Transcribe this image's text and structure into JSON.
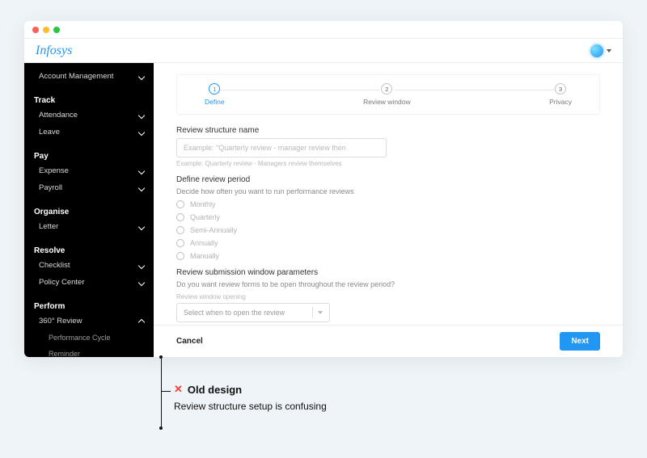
{
  "brand": "Infosys",
  "sidebar": {
    "groups": [
      {
        "title": null,
        "items": [
          {
            "label": "Account Management",
            "expandable": true
          }
        ]
      },
      {
        "title": "Track",
        "items": [
          {
            "label": "Attendance",
            "expandable": true
          },
          {
            "label": "Leave",
            "expandable": true
          }
        ]
      },
      {
        "title": "Pay",
        "items": [
          {
            "label": "Expense",
            "expandable": true
          },
          {
            "label": "Payroll",
            "expandable": true
          }
        ]
      },
      {
        "title": "Organise",
        "items": [
          {
            "label": "Letter",
            "expandable": true
          }
        ]
      },
      {
        "title": "Resolve",
        "items": [
          {
            "label": "Checklist",
            "expandable": true
          },
          {
            "label": "Policy Center",
            "expandable": true
          }
        ]
      },
      {
        "title": "Perform",
        "items": [
          {
            "label": "360° Review",
            "expandable": true,
            "expanded": true,
            "children": [
              {
                "label": "Performance Cycle"
              },
              {
                "label": "Reminder"
              }
            ]
          }
        ]
      }
    ]
  },
  "stepper": {
    "steps": [
      {
        "num": "1",
        "label": "Define",
        "active": true
      },
      {
        "num": "2",
        "label": "Review window",
        "active": false
      },
      {
        "num": "3",
        "label": "Privacy",
        "active": false
      }
    ]
  },
  "form": {
    "name_label": "Review structure name",
    "name_placeholder": "Example: \"Quarterly review - manager review then",
    "name_hint": "Example: Quarterly review - Managers review themselves",
    "period_label": "Define review period",
    "period_help": "Decide how often you want to run performance reviews",
    "period_options": [
      "Monthly",
      "Quarterly",
      "Semi-Annually",
      "Annually",
      "Manually"
    ],
    "submission_label": "Review submission window parameters",
    "submission_help": "Do you want review forms to be open throughout the review period?",
    "opening_minilabel": "Review window opening",
    "opening_placeholder": "Select when to open the review"
  },
  "footer": {
    "cancel": "Cancel",
    "next": "Next"
  },
  "annotation": {
    "title": "Old design",
    "subtitle": "Review structure setup is confusing"
  }
}
